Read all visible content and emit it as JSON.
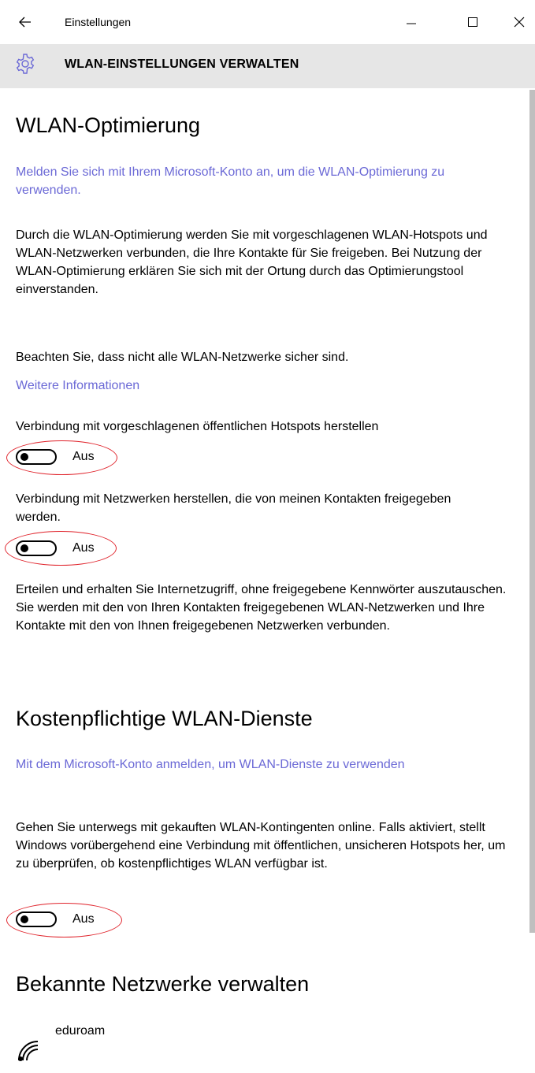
{
  "window": {
    "title": "Einstellungen"
  },
  "header": {
    "title": "WLAN-EINSTELLUNGEN VERWALTEN"
  },
  "sections": {
    "optimierung": {
      "heading": "WLAN-Optimierung",
      "signin_link": "Melden Sie sich mit Ihrem Microsoft-Konto an, um die WLAN-Optimierung zu verwenden.",
      "description": "Durch die WLAN-Optimierung werden Sie mit vorgeschlagenen WLAN-Hotspots und WLAN-Netzwerken verbunden, die Ihre Kontakte für Sie freigeben. Bei Nutzung der WLAN-Optimierung erklären Sie sich mit der Ortung durch das Optimierungstool einverstanden.",
      "warning": "Beachten Sie, dass nicht alle WLAN-Netzwerke sicher sind.",
      "more_info_link": "Weitere Informationen",
      "toggle1_label": "Verbindung mit vorgeschlagenen öffentlichen Hotspots herstellen",
      "toggle1_state": "Aus",
      "toggle2_label": "Verbindung mit Netzwerken herstellen, die von meinen Kontakten freigegeben werden.",
      "toggle2_state": "Aus",
      "sharing_text": "Erteilen und erhalten Sie Internetzugriff, ohne freigegebene Kennwörter auszutauschen. Sie werden mit den von Ihren Kontakten freigegebenen WLAN-Netzwerken und Ihre Kontakte mit den von Ihnen freigegebenen Netzwerken verbunden."
    },
    "kostenpflichtig": {
      "heading": "Kostenpflichtige WLAN-Dienste",
      "signin_link": "Mit dem Microsoft-Konto anmelden, um WLAN-Dienste zu verwenden",
      "description": "Gehen Sie unterwegs mit gekauften WLAN-Kontingenten online. Falls aktiviert, stellt Windows vorübergehend eine Verbindung mit öffentlichen, unsicheren Hotspots her, um zu überprüfen, ob kostenpflichtiges WLAN verfügbar ist.",
      "toggle_state": "Aus"
    },
    "bekannte": {
      "heading": "Bekannte Netzwerke verwalten",
      "networks": [
        {
          "name": "eduroam",
          "icon": "wifi-signal-icon"
        }
      ]
    }
  },
  "colors": {
    "link": "#6b69d6",
    "header_bg": "#e6e6e6",
    "annotation": "#e0242c"
  }
}
